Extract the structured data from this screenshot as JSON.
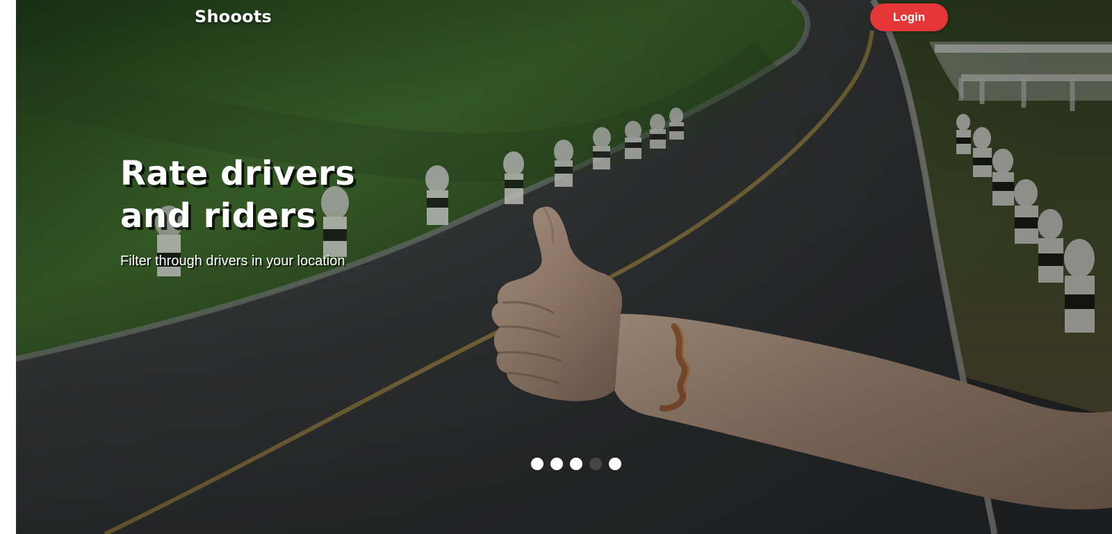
{
  "header": {
    "brand": "Shooots",
    "login_label": "Login"
  },
  "hero": {
    "title_line_1": "Rate drivers",
    "title_line_2": "and riders",
    "subtitle": "Filter through drivers in your location",
    "background_icon": "road-hitchhiker-image"
  },
  "carousel": {
    "slides": 5,
    "active_index": 3
  },
  "colors": {
    "accent": "#e53737",
    "active_dot": "#454545",
    "text": "#ffffff"
  }
}
